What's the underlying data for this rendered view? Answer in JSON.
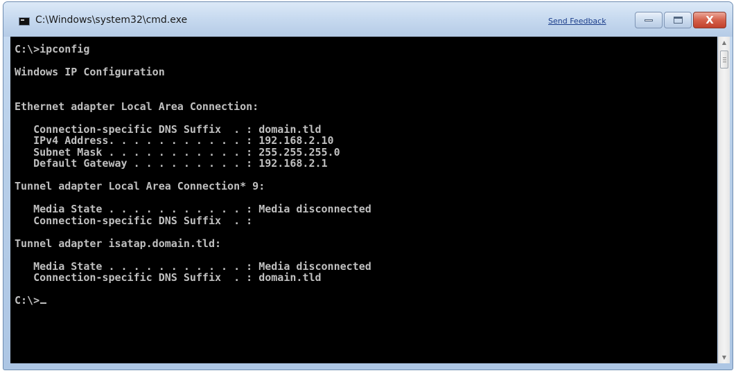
{
  "window": {
    "title": "C:\\Windows\\system32\\cmd.exe",
    "icon": "console-icon"
  },
  "titlebar": {
    "feedback_link": "Send Feedback",
    "minimize_icon": "minimize-icon",
    "maximize_icon": "maximize-icon",
    "close_icon": "close-icon",
    "close_glyph": "X"
  },
  "console": {
    "text_color": "#c0c0c0",
    "background": "#000000",
    "lines": [
      "C:\\>ipconfig",
      "",
      "Windows IP Configuration",
      "",
      "",
      "Ethernet adapter Local Area Connection:",
      "",
      "   Connection-specific DNS Suffix  . : domain.tld",
      "   IPv4 Address. . . . . . . . . . . : 192.168.2.10",
      "   Subnet Mask . . . . . . . . . . . : 255.255.255.0",
      "   Default Gateway . . . . . . . . . : 192.168.2.1",
      "",
      "Tunnel adapter Local Area Connection* 9:",
      "",
      "   Media State . . . . . . . . . . . : Media disconnected",
      "   Connection-specific DNS Suffix  . :",
      "",
      "Tunnel adapter isatap.domain.tld:",
      "",
      "   Media State . . . . . . . . . . . : Media disconnected",
      "   Connection-specific DNS Suffix  . : domain.tld",
      "",
      "C:\\>"
    ]
  },
  "scrollbar": {
    "up_arrow": "▲",
    "down_arrow": "▼"
  }
}
